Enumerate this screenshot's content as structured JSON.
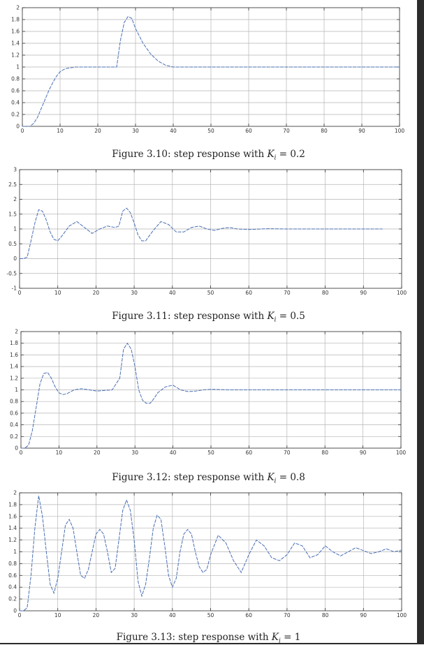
{
  "colors": {
    "line": "#4a6fb5",
    "grid": "#b5b5b5",
    "axis": "#333333"
  },
  "chart_data": [
    {
      "type": "line",
      "grid": true,
      "xlim": [
        0,
        100
      ],
      "ylim": [
        0,
        2
      ],
      "x_ticks": [
        0,
        10,
        20,
        30,
        40,
        50,
        60,
        70,
        80,
        90,
        100
      ],
      "y_ticks": [
        0,
        0.2,
        0.4,
        0.6,
        0.8,
        1,
        1.2,
        1.4,
        1.6,
        1.8,
        2
      ],
      "caption": {
        "prefix": "Figure 3.10: step response with ",
        "var": "K",
        "sub": "i",
        "value": " = 0.2"
      },
      "series": [
        {
          "x": [
            0,
            2,
            3,
            4,
            5,
            6,
            7,
            8,
            9,
            10,
            11,
            12,
            14,
            16,
            20,
            25,
            26,
            27,
            28,
            29,
            30,
            32,
            34,
            36,
            38,
            40,
            45,
            50,
            60,
            70,
            80,
            90,
            100
          ],
          "y": [
            0,
            0,
            0.05,
            0.15,
            0.3,
            0.45,
            0.6,
            0.73,
            0.84,
            0.92,
            0.96,
            0.98,
            1,
            1,
            1,
            1,
            1.45,
            1.75,
            1.85,
            1.82,
            1.65,
            1.4,
            1.22,
            1.1,
            1.03,
            1,
            1,
            1,
            1,
            1,
            1,
            1,
            1
          ]
        }
      ]
    },
    {
      "type": "line",
      "grid": true,
      "xlim": [
        0,
        100
      ],
      "ylim": [
        -1,
        3
      ],
      "x_ticks": [
        0,
        10,
        20,
        30,
        40,
        50,
        60,
        70,
        80,
        90,
        100
      ],
      "y_ticks": [
        -1,
        -0.5,
        0,
        0.5,
        1,
        1.5,
        2,
        2.5,
        3
      ],
      "caption": {
        "prefix": "Figure 3.11: step response with ",
        "var": "K",
        "sub": "i",
        "value": " = 0.5"
      },
      "series": [
        {
          "x": [
            0,
            1,
            2,
            3,
            4,
            5,
            6,
            7,
            8,
            9,
            10,
            11,
            13,
            15,
            17,
            19,
            21,
            23,
            25,
            26,
            27,
            28,
            29,
            30,
            31,
            32,
            33,
            35,
            37,
            39,
            41,
            43,
            45,
            47,
            49,
            51,
            53,
            55,
            57,
            60,
            65,
            70,
            75,
            80,
            85,
            90,
            95
          ],
          "y": [
            0,
            0,
            0.05,
            0.6,
            1.2,
            1.65,
            1.6,
            1.3,
            0.9,
            0.65,
            0.6,
            0.75,
            1.1,
            1.25,
            1.05,
            0.85,
            1.0,
            1.1,
            1.05,
            1.1,
            1.6,
            1.7,
            1.55,
            1.2,
            0.8,
            0.6,
            0.6,
            0.95,
            1.25,
            1.15,
            0.9,
            0.9,
            1.05,
            1.1,
            1.0,
            0.95,
            1.02,
            1.05,
            1.0,
            0.98,
            1.01,
            1,
            1,
            1,
            1,
            1,
            1
          ]
        }
      ]
    },
    {
      "type": "line",
      "grid": true,
      "xlim": [
        0,
        100
      ],
      "ylim": [
        0,
        2
      ],
      "x_ticks": [
        0,
        10,
        20,
        30,
        40,
        50,
        60,
        70,
        80,
        90,
        100
      ],
      "y_ticks": [
        0,
        0.2,
        0.4,
        0.6,
        0.8,
        1,
        1.2,
        1.4,
        1.6,
        1.8,
        2
      ],
      "caption": {
        "prefix": "Figure 3.12: step response with ",
        "var": "K",
        "sub": "i",
        "value": " = 0.8"
      },
      "series": [
        {
          "x": [
            0,
            1,
            2,
            3,
            4,
            5,
            6,
            7,
            8,
            9,
            10,
            11,
            12,
            14,
            16,
            18,
            20,
            22,
            24,
            26,
            27,
            28,
            29,
            30,
            31,
            32,
            33,
            34,
            35,
            36,
            38,
            40,
            42,
            44,
            46,
            48,
            50,
            55,
            60,
            70,
            80,
            90,
            100
          ],
          "y": [
            0,
            0,
            0.05,
            0.3,
            0.7,
            1.1,
            1.28,
            1.3,
            1.2,
            1.05,
            0.95,
            0.92,
            0.93,
            1.0,
            1.02,
            1.0,
            0.98,
            0.99,
            1.0,
            1.2,
            1.7,
            1.8,
            1.7,
            1.4,
            1.0,
            0.82,
            0.77,
            0.77,
            0.85,
            0.95,
            1.05,
            1.08,
            1.0,
            0.97,
            0.98,
            1.0,
            1.01,
            1,
            1,
            1,
            1,
            1,
            1
          ]
        }
      ]
    },
    {
      "type": "line",
      "grid": true,
      "xlim": [
        0,
        100
      ],
      "ylim": [
        0,
        2
      ],
      "x_ticks": [
        0,
        10,
        20,
        30,
        40,
        50,
        60,
        70,
        80,
        90,
        100
      ],
      "y_ticks": [
        0,
        0.2,
        0.4,
        0.6,
        0.8,
        1,
        1.2,
        1.4,
        1.6,
        1.8,
        2
      ],
      "caption": {
        "prefix": "Figure 3.13: step response with ",
        "var": "K",
        "sub": "i",
        "value": " = 1"
      },
      "series": [
        {
          "x": [
            0,
            1,
            2,
            3,
            4,
            5,
            6,
            7,
            8,
            9,
            10,
            11,
            12,
            13,
            14,
            15,
            16,
            17,
            18,
            19,
            20,
            21,
            22,
            23,
            24,
            25,
            26,
            27,
            28,
            29,
            30,
            31,
            32,
            33,
            34,
            35,
            36,
            37,
            38,
            39,
            40,
            41,
            42,
            43,
            44,
            45,
            46,
            47,
            48,
            49,
            50,
            52,
            54,
            56,
            58,
            60,
            62,
            64,
            66,
            68,
            70,
            72,
            74,
            76,
            78,
            80,
            82,
            84,
            86,
            88,
            90,
            92,
            94,
            96,
            98,
            100
          ],
          "y": [
            0,
            0,
            0.05,
            0.6,
            1.4,
            1.95,
            1.6,
            1.0,
            0.45,
            0.3,
            0.55,
            1.0,
            1.45,
            1.55,
            1.4,
            1.0,
            0.6,
            0.55,
            0.7,
            1.0,
            1.3,
            1.38,
            1.3,
            1.0,
            0.65,
            0.72,
            1.2,
            1.7,
            1.88,
            1.7,
            1.2,
            0.5,
            0.25,
            0.45,
            0.9,
            1.4,
            1.62,
            1.55,
            1.1,
            0.6,
            0.4,
            0.55,
            1.0,
            1.3,
            1.38,
            1.3,
            1.0,
            0.75,
            0.65,
            0.7,
            0.95,
            1.28,
            1.15,
            0.85,
            0.65,
            0.95,
            1.2,
            1.1,
            0.9,
            0.85,
            0.95,
            1.15,
            1.1,
            0.9,
            0.95,
            1.1,
            1.0,
            0.93,
            1.0,
            1.07,
            1.02,
            0.97,
            1.0,
            1.05,
            1.0,
            1.03
          ]
        }
      ]
    }
  ]
}
